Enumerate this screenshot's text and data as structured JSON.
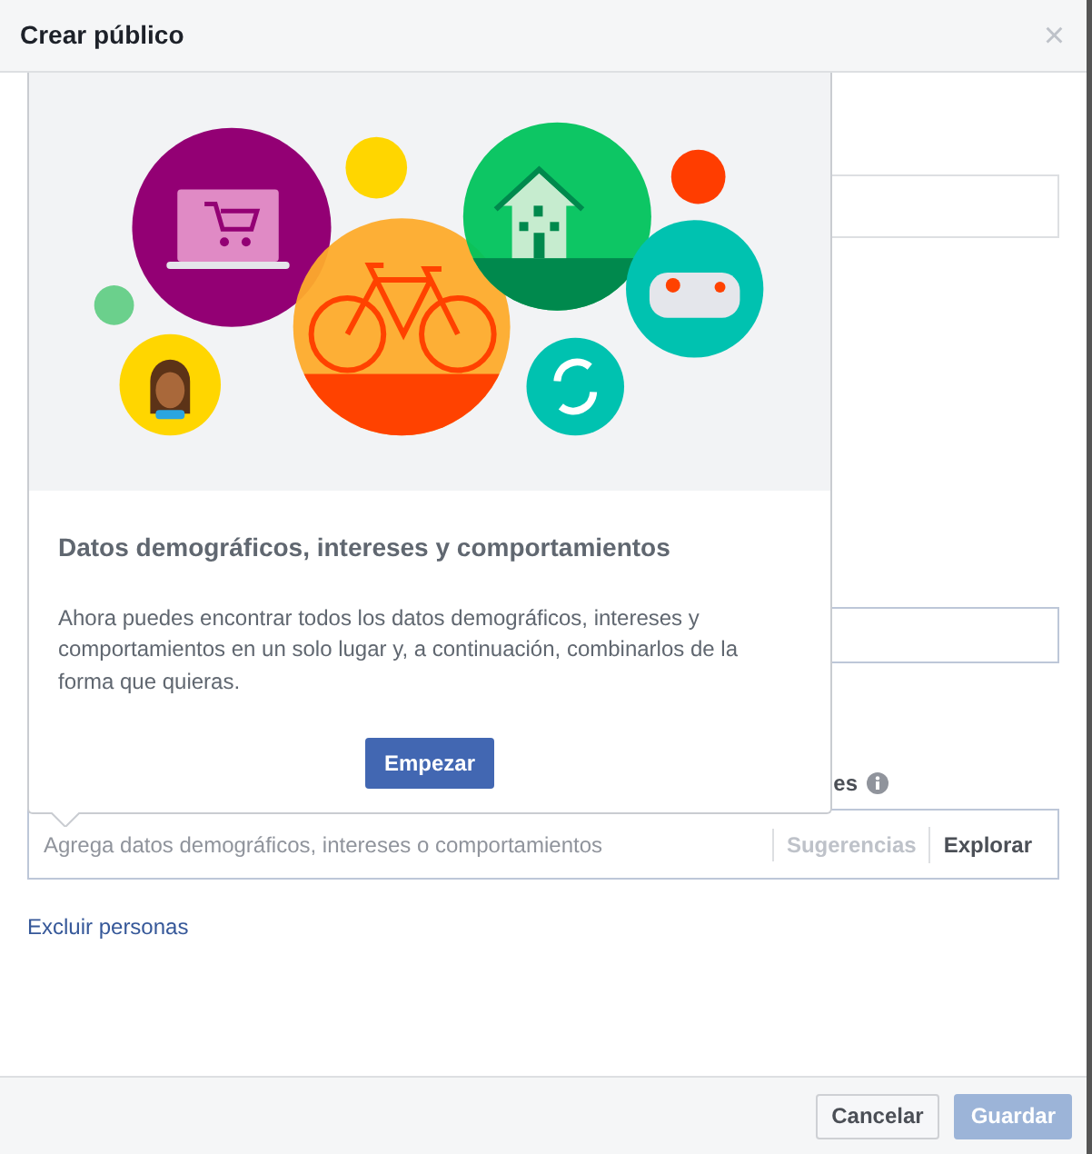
{
  "dialog": {
    "title": "Crear público",
    "close": "×"
  },
  "background": {
    "label_fragment": "es",
    "field": {
      "placeholder": "Agrega datos demográficos, intereses o comportamientos",
      "suggestions": "Sugerencias",
      "explore": "Explorar"
    },
    "exclude_link": "Excluir personas"
  },
  "popover": {
    "title": "Datos demográficos, intereses y comportamientos",
    "text": "Ahora puedes encontrar todos los datos demográficos, intereses y comportamientos en un solo lugar y, a continuación, combinarlos de la forma que quieras.",
    "button": "Empezar"
  },
  "footer": {
    "buttons": [
      {
        "label": "Cancelar",
        "kind": "secondary",
        "disabled": false
      },
      {
        "label": "Guardar",
        "kind": "primary",
        "disabled": true
      }
    ]
  }
}
